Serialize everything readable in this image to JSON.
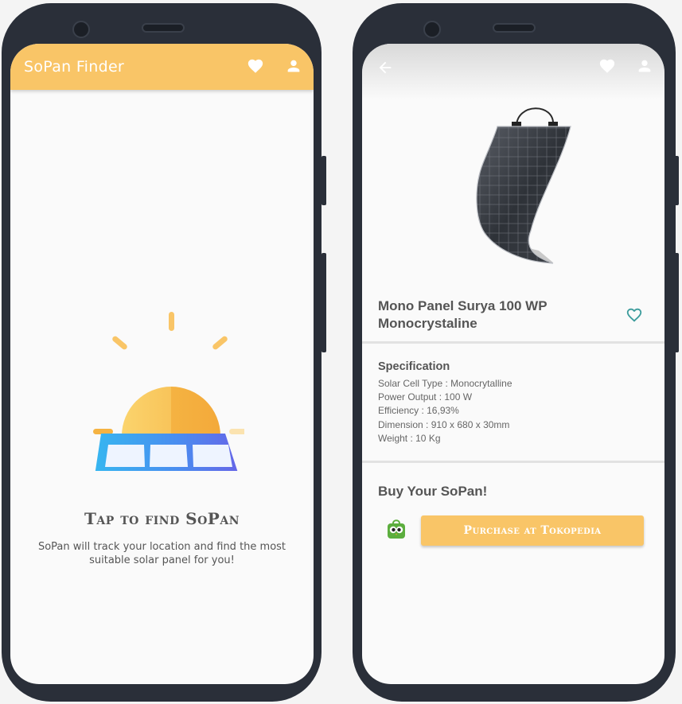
{
  "left_screen": {
    "app_title": "SoPan Finder",
    "icons": {
      "favorite": "heart-icon",
      "profile": "person-icon"
    },
    "illustration": "solar-panel-sun-illustration",
    "tap_title": "Tap to find SoPan",
    "tap_description": "SoPan will track your location and find the most suitable solar panel for you!"
  },
  "right_screen": {
    "icons": {
      "back": "arrow-back-icon",
      "favorite": "heart-icon",
      "profile": "person-icon",
      "product_favorite": "heart-outline-icon",
      "store": "tokopedia-icon"
    },
    "product_name": "Mono Panel Surya 100 WP Monocrystaline",
    "spec_title": "Specification",
    "specs": [
      "Solar Cell Type : Monocrytalline",
      "Power Output : 100 W",
      "Efficiency : 16,93%",
      "Dimension : 910 x 680 x 30mm",
      "Weight : 10 Kg"
    ],
    "buy_title": "Buy Your SoPan!",
    "purchase_label": "Purchase at Tokopedia"
  },
  "colors": {
    "accent": "#f9c567",
    "teal": "#3c9c9c",
    "frame": "#2a2f39",
    "text": "#555555"
  }
}
